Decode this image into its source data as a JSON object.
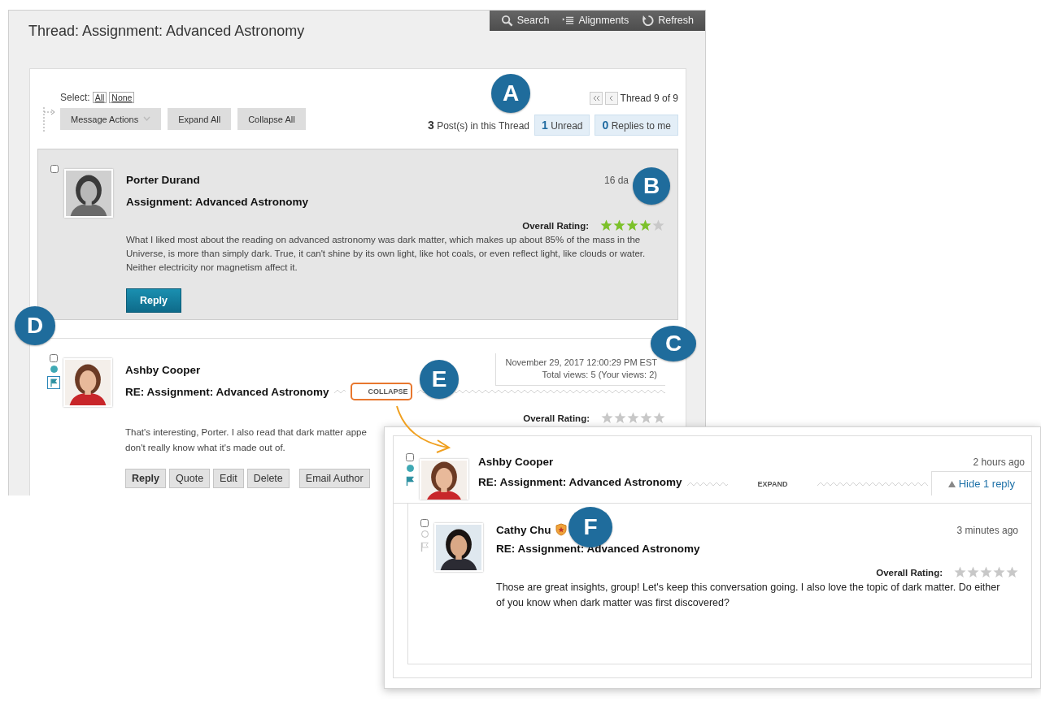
{
  "thread_title": "Thread: Assignment: Advanced Astronomy",
  "toolbar": [
    {
      "label": "Search"
    },
    {
      "label": "Alignments"
    },
    {
      "label": "Refresh"
    }
  ],
  "select": {
    "label": "Select:",
    "links": [
      "All",
      "None"
    ]
  },
  "actions": [
    {
      "label": "Message Actions",
      "dropdown": true
    },
    {
      "label": "Expand All",
      "dropdown": false
    },
    {
      "label": "Collapse All",
      "dropdown": false
    }
  ],
  "pager": {
    "label": "Thread 9 of 9"
  },
  "summary": {
    "posts_count": "3",
    "posts_label": "Post(s) in this Thread",
    "unread_count": "1",
    "unread_label": "Unread",
    "replies_count": "0",
    "replies_label": "Replies to me"
  },
  "posts": [
    {
      "checked": false,
      "author": "Porter Durand",
      "title": "Assignment: Advanced Astronomy",
      "highlighted": true,
      "date": "16 da",
      "rating_label": "Overall Rating:",
      "stars": 4,
      "body": [
        "What I liked most about the reading on advanced astronomy was dark matter, which makes up about 85% of the mass in the Universe, is more than simply dark. True, it can't shine by its own light, like hot coals, or even reflect light, like clouds or water. Neither electricity nor magnetism affect it."
      ],
      "buttons": [
        {
          "label": "Reply",
          "kind": "primary"
        }
      ]
    },
    {
      "checked": false,
      "author": "Ashby Cooper",
      "title": "RE: Assignment: Advanced Astronomy",
      "highlighted": false,
      "unread": true,
      "flagged": true,
      "date": "November 29, 2017 12:00:29 PM EST",
      "views": "Total views: 5 (Your views: 2)",
      "toggle": {
        "label": "COLLAPSE",
        "highlighted": true
      },
      "rating_label": "Overall Rating:",
      "stars": 0,
      "body": [
        "That's interesting, Porter. I also read that dark matter appe",
        "don't really know what it's made out of."
      ],
      "buttons": [
        {
          "label": "Reply",
          "kind": "strong"
        },
        {
          "label": "Quote",
          "kind": "plain"
        },
        {
          "label": "Edit",
          "kind": "plain"
        },
        {
          "label": "Delete",
          "kind": "plain"
        },
        {
          "label": "Email Author",
          "kind": "plain"
        }
      ]
    }
  ],
  "detail": {
    "post": {
      "checked": false,
      "author": "Ashby Cooper",
      "title": "RE: Assignment: Advanced Astronomy",
      "unread": true,
      "flagged": true,
      "date": "2 hours ago",
      "toggle": {
        "label": "EXPAND",
        "highlighted": false
      },
      "hide_replies": "Hide 1 reply"
    },
    "reply": {
      "checked": false,
      "author": "Cathy Chu",
      "badge": true,
      "title": "RE: Assignment: Advanced Astronomy",
      "unread": false,
      "flagged": false,
      "date": "3 minutes ago",
      "rating_label": "Overall Rating:",
      "stars": 0,
      "body": [
        "Those are great insights, group! Let's keep this conversation going. I also love the topic of dark matter. Do either of you know when dark matter was first discovered?"
      ]
    }
  },
  "callouts": [
    {
      "label": "A"
    },
    {
      "label": "B"
    },
    {
      "label": "C"
    },
    {
      "label": "D"
    },
    {
      "label": "E"
    },
    {
      "label": "F"
    }
  ]
}
